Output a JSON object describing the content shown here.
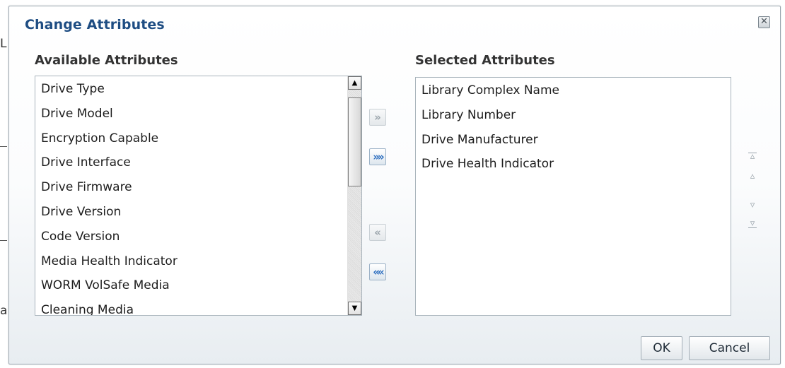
{
  "background": {
    "fragment_top": "L",
    "fragment_bottom": "a"
  },
  "dialog": {
    "title": "Change Attributes",
    "close_icon": "close-icon",
    "available": {
      "label": "Available Attributes",
      "items": [
        "Drive Type",
        "Drive Model",
        "Encryption Capable",
        "Drive Interface",
        "Drive Firmware",
        "Drive Version",
        "Code Version",
        "Media Health Indicator",
        "WORM VolSafe Media",
        "Cleaning Media"
      ]
    },
    "selected": {
      "label": "Selected Attributes",
      "items": [
        "Library Complex Name",
        "Library Number",
        "Drive Manufacturer",
        "Drive Health Indicator"
      ]
    },
    "shuttle": {
      "move_icon": "chevron-right-icon",
      "move_all_icon": "double-chevron-right-icon",
      "remove_icon": "chevron-left-icon",
      "remove_all_icon": "double-chevron-left-icon"
    },
    "reorder": {
      "top_icon": "move-to-top-icon",
      "up_icon": "move-up-icon",
      "down_icon": "move-down-icon",
      "bottom_icon": "move-to-bottom-icon"
    },
    "footer": {
      "ok_label": "OK",
      "cancel_label": "Cancel"
    }
  },
  "colors": {
    "title": "#1e4d83",
    "accent": "#2e6fc0",
    "disabled": "#9aa4ab"
  }
}
